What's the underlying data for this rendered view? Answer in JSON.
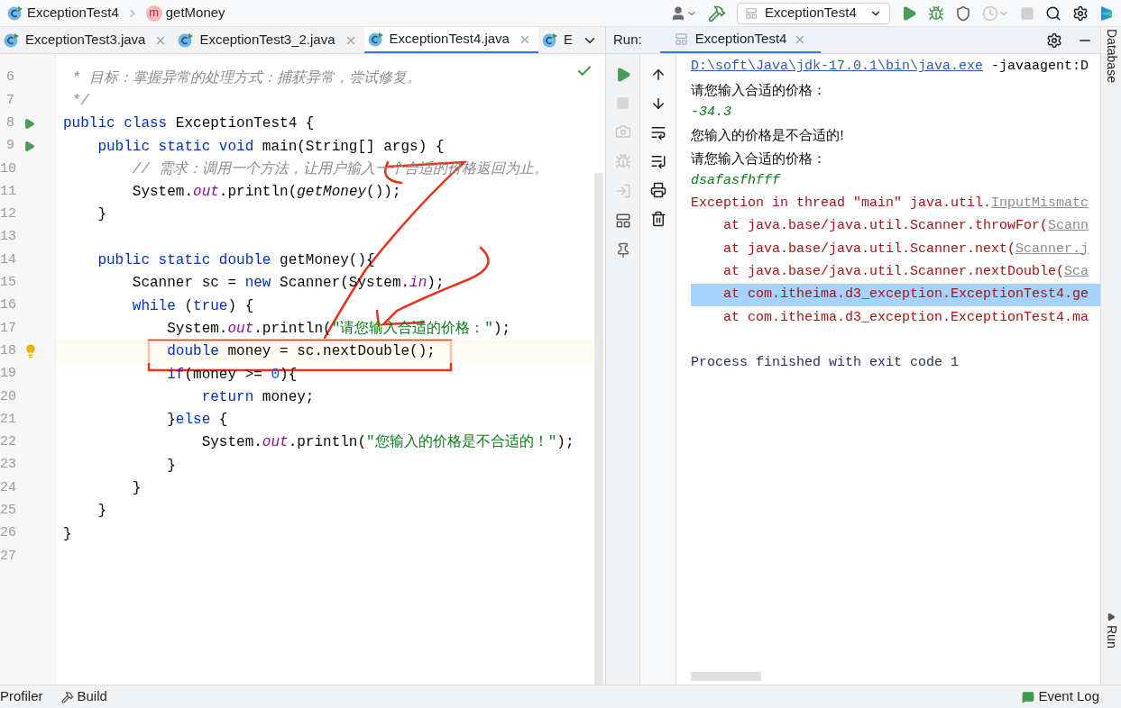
{
  "breadcrumb": [
    {
      "kind": "class",
      "label": "ExceptionTest4"
    },
    {
      "kind": "method",
      "badge": "m",
      "label": "getMoney"
    }
  ],
  "run_config": {
    "label": "ExceptionTest4"
  },
  "editor_tabs": [
    {
      "label": "ExceptionTest3.java",
      "selected": false,
      "closable": true
    },
    {
      "label": "ExceptionTest3_2.java",
      "selected": false,
      "closable": true
    },
    {
      "label": "ExceptionTest4.java",
      "selected": true,
      "closable": true
    },
    {
      "label": "E",
      "selected": false,
      "closable": false
    }
  ],
  "code_lines": [
    {
      "number": "6",
      "kind": "plain",
      "current": false,
      "segments": [
        {
          "kind": "comment",
          "text": " * 目标：掌握异常的处理方式：捕获异常，尝试修复。"
        }
      ]
    },
    {
      "number": "7",
      "kind": "plain",
      "current": false,
      "segments": [
        {
          "kind": "comment",
          "text": " */"
        }
      ]
    },
    {
      "number": "8",
      "kind": "run",
      "current": false,
      "segments": [
        {
          "kind": "kw",
          "text": "public class "
        },
        {
          "kind": "plain",
          "text": "ExceptionTest4 {"
        }
      ]
    },
    {
      "number": "9",
      "kind": "run",
      "current": false,
      "segments": [
        {
          "kind": "kw",
          "text": "    public static void "
        },
        {
          "kind": "plain",
          "text": "main(String[] args) {"
        }
      ]
    },
    {
      "number": "10",
      "kind": "plain",
      "current": false,
      "segments": [
        {
          "kind": "comment",
          "text": "        // 需求：调用一个方法，让用户输入一个合适的价格返回为止。"
        }
      ]
    },
    {
      "number": "11",
      "kind": "plain",
      "current": false,
      "segments": [
        {
          "kind": "plain",
          "text": "        System."
        },
        {
          "kind": "field",
          "text": "out"
        },
        {
          "kind": "plain",
          "text": ".println("
        },
        {
          "kind": "static",
          "text": "getMoney"
        },
        {
          "kind": "plain",
          "text": "());"
        }
      ]
    },
    {
      "number": "12",
      "kind": "plain",
      "current": false,
      "segments": [
        {
          "kind": "plain",
          "text": "    }"
        }
      ]
    },
    {
      "number": "13",
      "kind": "plain",
      "current": false
    },
    {
      "number": "14",
      "kind": "plain",
      "current": false,
      "segments": [
        {
          "kind": "kw",
          "text": "    public static double "
        },
        {
          "kind": "plain",
          "text": "getMoney(){"
        }
      ]
    },
    {
      "number": "15",
      "kind": "plain",
      "current": false,
      "segments": [
        {
          "kind": "plain",
          "text": "        Scanner sc = "
        },
        {
          "kind": "kw",
          "text": "new"
        },
        {
          "kind": "plain",
          "text": " Scanner(System."
        },
        {
          "kind": "field",
          "text": "in"
        },
        {
          "kind": "plain",
          "text": ");"
        }
      ]
    },
    {
      "number": "16",
      "kind": "plain",
      "current": false,
      "segments": [
        {
          "kind": "kw",
          "text": "        while"
        },
        {
          "kind": "plain",
          "text": " ("
        },
        {
          "kind": "kw",
          "text": "true"
        },
        {
          "kind": "plain",
          "text": ") {"
        }
      ]
    },
    {
      "number": "17",
      "kind": "plain",
      "current": false,
      "segments": [
        {
          "kind": "plain",
          "text": "            System."
        },
        {
          "kind": "field",
          "text": "out"
        },
        {
          "kind": "plain",
          "text": ".println("
        },
        {
          "kind": "string",
          "text": "\"请您输入合适的价格：\""
        },
        {
          "kind": "plain",
          "text": ");"
        }
      ]
    },
    {
      "number": "18",
      "kind": "bulb",
      "current": true,
      "segments": [
        {
          "kind": "kw",
          "text": "            double"
        },
        {
          "kind": "plain",
          "text": " money = sc.nextDouble();"
        }
      ]
    },
    {
      "number": "19",
      "kind": "plain",
      "current": false,
      "segments": [
        {
          "kind": "kw",
          "text": "            if"
        },
        {
          "kind": "plain",
          "text": "(money >= "
        },
        {
          "kind": "num",
          "text": "0"
        },
        {
          "kind": "plain",
          "text": "){"
        }
      ]
    },
    {
      "number": "20",
      "kind": "plain",
      "current": false,
      "segments": [
        {
          "kind": "kw",
          "text": "                return"
        },
        {
          "kind": "plain",
          "text": " money;"
        }
      ]
    },
    {
      "number": "21",
      "kind": "plain",
      "current": false,
      "segments": [
        {
          "kind": "plain",
          "text": "            }"
        },
        {
          "kind": "kw",
          "text": "else"
        },
        {
          "kind": "plain",
          "text": " {"
        }
      ]
    },
    {
      "number": "22",
      "kind": "plain",
      "current": false,
      "segments": [
        {
          "kind": "plain",
          "text": "                System."
        },
        {
          "kind": "field",
          "text": "out"
        },
        {
          "kind": "plain",
          "text": ".println("
        },
        {
          "kind": "string",
          "text": "\"您输入的价格是不合适的！\""
        },
        {
          "kind": "plain",
          "text": ");"
        }
      ]
    },
    {
      "number": "23",
      "kind": "plain",
      "current": false,
      "segments": [
        {
          "kind": "plain",
          "text": "            }"
        }
      ]
    },
    {
      "number": "24",
      "kind": "plain",
      "current": false,
      "segments": [
        {
          "kind": "plain",
          "text": "        }"
        }
      ]
    },
    {
      "number": "25",
      "kind": "plain",
      "current": false,
      "segments": [
        {
          "kind": "plain",
          "text": "    }"
        }
      ]
    },
    {
      "number": "26",
      "kind": "plain",
      "current": false,
      "segments": [
        {
          "kind": "plain",
          "text": "}"
        }
      ]
    },
    {
      "number": "27",
      "kind": "plain",
      "current": false
    }
  ],
  "run_panel": {
    "label": "Run:",
    "tab": "ExceptionTest4"
  },
  "console_lines": [
    {
      "kind": "command",
      "selected": false,
      "segments": [
        {
          "text": "D:\\soft\\Java\\jdk-17.0.1\\bin\\java.exe",
          "link": true
        },
        {
          "text": " -javaagent:D",
          "link": false
        }
      ]
    },
    {
      "kind": "output",
      "selected": false,
      "segments": [
        {
          "text": "请您输入合适的价格：",
          "link": false
        }
      ]
    },
    {
      "kind": "input",
      "selected": false,
      "segments": [
        {
          "text": "-34.3",
          "link": false
        }
      ]
    },
    {
      "kind": "output",
      "selected": false,
      "segments": [
        {
          "text": "您输入的价格是不合适的!",
          "link": false
        }
      ]
    },
    {
      "kind": "output",
      "selected": false,
      "segments": [
        {
          "text": "请您输入合适的价格：",
          "link": false
        }
      ]
    },
    {
      "kind": "input",
      "selected": false,
      "segments": [
        {
          "text": "dsafasfhfff",
          "link": false
        }
      ]
    },
    {
      "kind": "error",
      "selected": false,
      "segments": [
        {
          "text": "Exception in thread \"main\" java.util.",
          "link": false
        },
        {
          "text": "InputMismatc",
          "link": true
        }
      ]
    },
    {
      "kind": "error",
      "selected": false,
      "segments": [
        {
          "text": "    at java.base/java.util.Scanner.throwFor(",
          "link": false
        },
        {
          "text": "Scann",
          "link": true
        }
      ]
    },
    {
      "kind": "error",
      "selected": false,
      "segments": [
        {
          "text": "    at java.base/java.util.Scanner.next(",
          "link": false
        },
        {
          "text": "Scanner.j",
          "link": true
        }
      ]
    },
    {
      "kind": "error",
      "selected": false,
      "segments": [
        {
          "text": "    at java.base/java.util.Scanner.nextDouble(",
          "link": false
        },
        {
          "text": "Sca",
          "link": true
        }
      ]
    },
    {
      "kind": "error",
      "selected": true,
      "segments": [
        {
          "text": "    at com.itheima.d3_exception.ExceptionTest4.ge",
          "link": false
        }
      ]
    },
    {
      "kind": "error",
      "selected": false,
      "segments": [
        {
          "text": "    at com.itheima.d3_exception.ExceptionTest4.ma",
          "link": false
        }
      ]
    },
    {
      "kind": "blank",
      "selected": false
    },
    {
      "kind": "exit",
      "selected": false,
      "segments": [
        {
          "text": "Process finished with exit code 1",
          "link": false
        }
      ]
    }
  ],
  "right_stripe": {
    "top": "Database",
    "bottom": "Run"
  },
  "status_bar": {
    "left": [
      {
        "kind": "profiler",
        "label": "Profiler"
      },
      {
        "kind": "build",
        "label": "Build"
      }
    ],
    "right": "Event Log"
  }
}
